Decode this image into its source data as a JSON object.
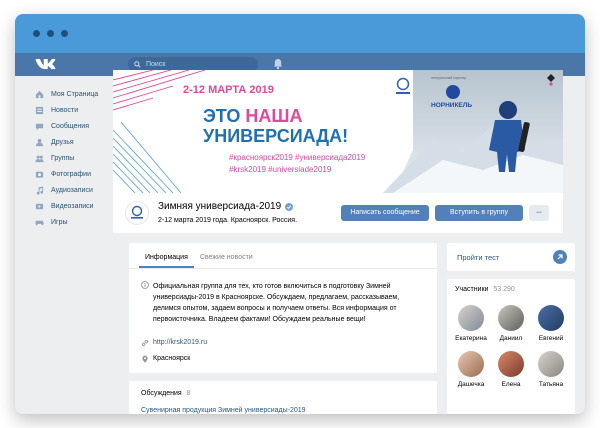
{
  "nav": {
    "search_placeholder": "Поиск",
    "accent": "#4a76a8"
  },
  "sidebar": {
    "items": [
      {
        "label": "Моя Страница",
        "icon": "home-icon"
      },
      {
        "label": "Новости",
        "icon": "news-icon"
      },
      {
        "label": "Сообщения",
        "icon": "messages-icon"
      },
      {
        "label": "Друзья",
        "icon": "friends-icon"
      },
      {
        "label": "Группы",
        "icon": "groups-icon"
      },
      {
        "label": "Фотографии",
        "icon": "photos-icon"
      },
      {
        "label": "Аудиозаписи",
        "icon": "audio-icon"
      },
      {
        "label": "Видеозаписи",
        "icon": "video-icon"
      },
      {
        "label": "Игры",
        "icon": "games-icon"
      }
    ]
  },
  "cover": {
    "date": "2-12 МАРТА 2019",
    "headline_1": "ЭТО",
    "headline_2": "НАША",
    "headline_3": "УНИВЕРСИАДА!",
    "hashtags_1": "#красноярск2019 #универсиада2019",
    "hashtags_2": "#krsk2019 #universiade2019",
    "partner_label": "НОРНИКЕЛЬ",
    "partner_small": "генеральный партнер"
  },
  "group": {
    "name": "Зимняя универсиада-2019",
    "status": "2-12 марта 2019 года. Красноярск. Россия.",
    "message_button": "Написать сообщение",
    "join_button": "Вступить в группу",
    "more_button": "•••"
  },
  "info": {
    "tabs": [
      "Информация",
      "Свежие новости"
    ],
    "description": "Официальная группа для тех, кто готов включиться в подготовку Зимней универсиады-2019 в Красноярске. Обсуждаем, предлагаем, рассказываем, делимся опытом, задаем вопросы и получаем ответы. Вся информация от первоисточника. Владеем фактами! Обсуждаем реальные вещи!",
    "link": "http://krsk2019.ru",
    "city": "Красноярск"
  },
  "discussions": {
    "title": "Обсуждения",
    "count": "8",
    "first_topic": "Сувенирная продукция Зимней универсиады-2019"
  },
  "test": {
    "label": "Пройти тест"
  },
  "members": {
    "title": "Участники",
    "count": "53 290",
    "people": [
      "Екатерина",
      "Даниил",
      "Евгений",
      "Дашечка",
      "Елена",
      "Татьяна"
    ]
  }
}
